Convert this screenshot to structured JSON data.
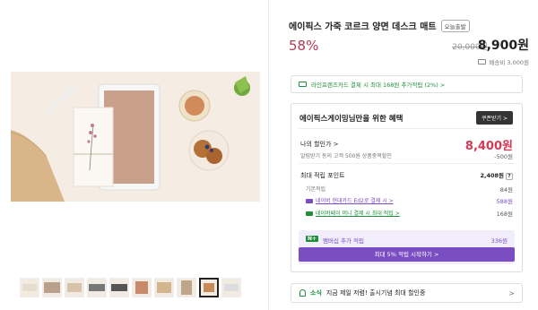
{
  "product": {
    "title": "에이픽스 가죽 코르크 양면 데스크 매트",
    "badge": "오늘출발",
    "discount": "58%",
    "original_price": "20,000원",
    "price": "8,900원",
    "shipping": "배송비 3,000원"
  },
  "card_promo": {
    "text": "라인프렌즈카드 결제 시 최대 168원 추가적립 (2%) >"
  },
  "benefit": {
    "heading": "에이픽스게이밍님만을 위한 혜택",
    "coupon_button": "쿠폰받기 >",
    "my_price_label": "나의 할인가 >",
    "my_price": "8,400원",
    "alarm_label": "알림받기 동의 고객 500원 상품중복할인",
    "alarm_value": "-500원",
    "points_label": "최대 적립 포인트",
    "points_value": "2,408원",
    "points_help": "?",
    "basic_label": "기본적립",
    "basic_value": "84원",
    "hyundai_label": "네이버 현대카드 Ed2로 결제 시 >",
    "hyundai_value": "588원",
    "naverpay_label": "네이버페이 머니 결제 시 최대 적립 >",
    "naverpay_value": "168원",
    "member_tag": "N+",
    "member_label": "멤버십 추가 적립",
    "member_value": "336원",
    "member_button": "최대 5% 적립 시작하기 >"
  },
  "news": {
    "tag": "소식",
    "text": "지금 제일 저렴! 출시기념 최대 할인중",
    "chevron": ">"
  },
  "colors": {
    "discount": "#b13a55",
    "price_red": "#d23a55",
    "green": "#1f8f3a",
    "purple": "#7a4dc2"
  }
}
